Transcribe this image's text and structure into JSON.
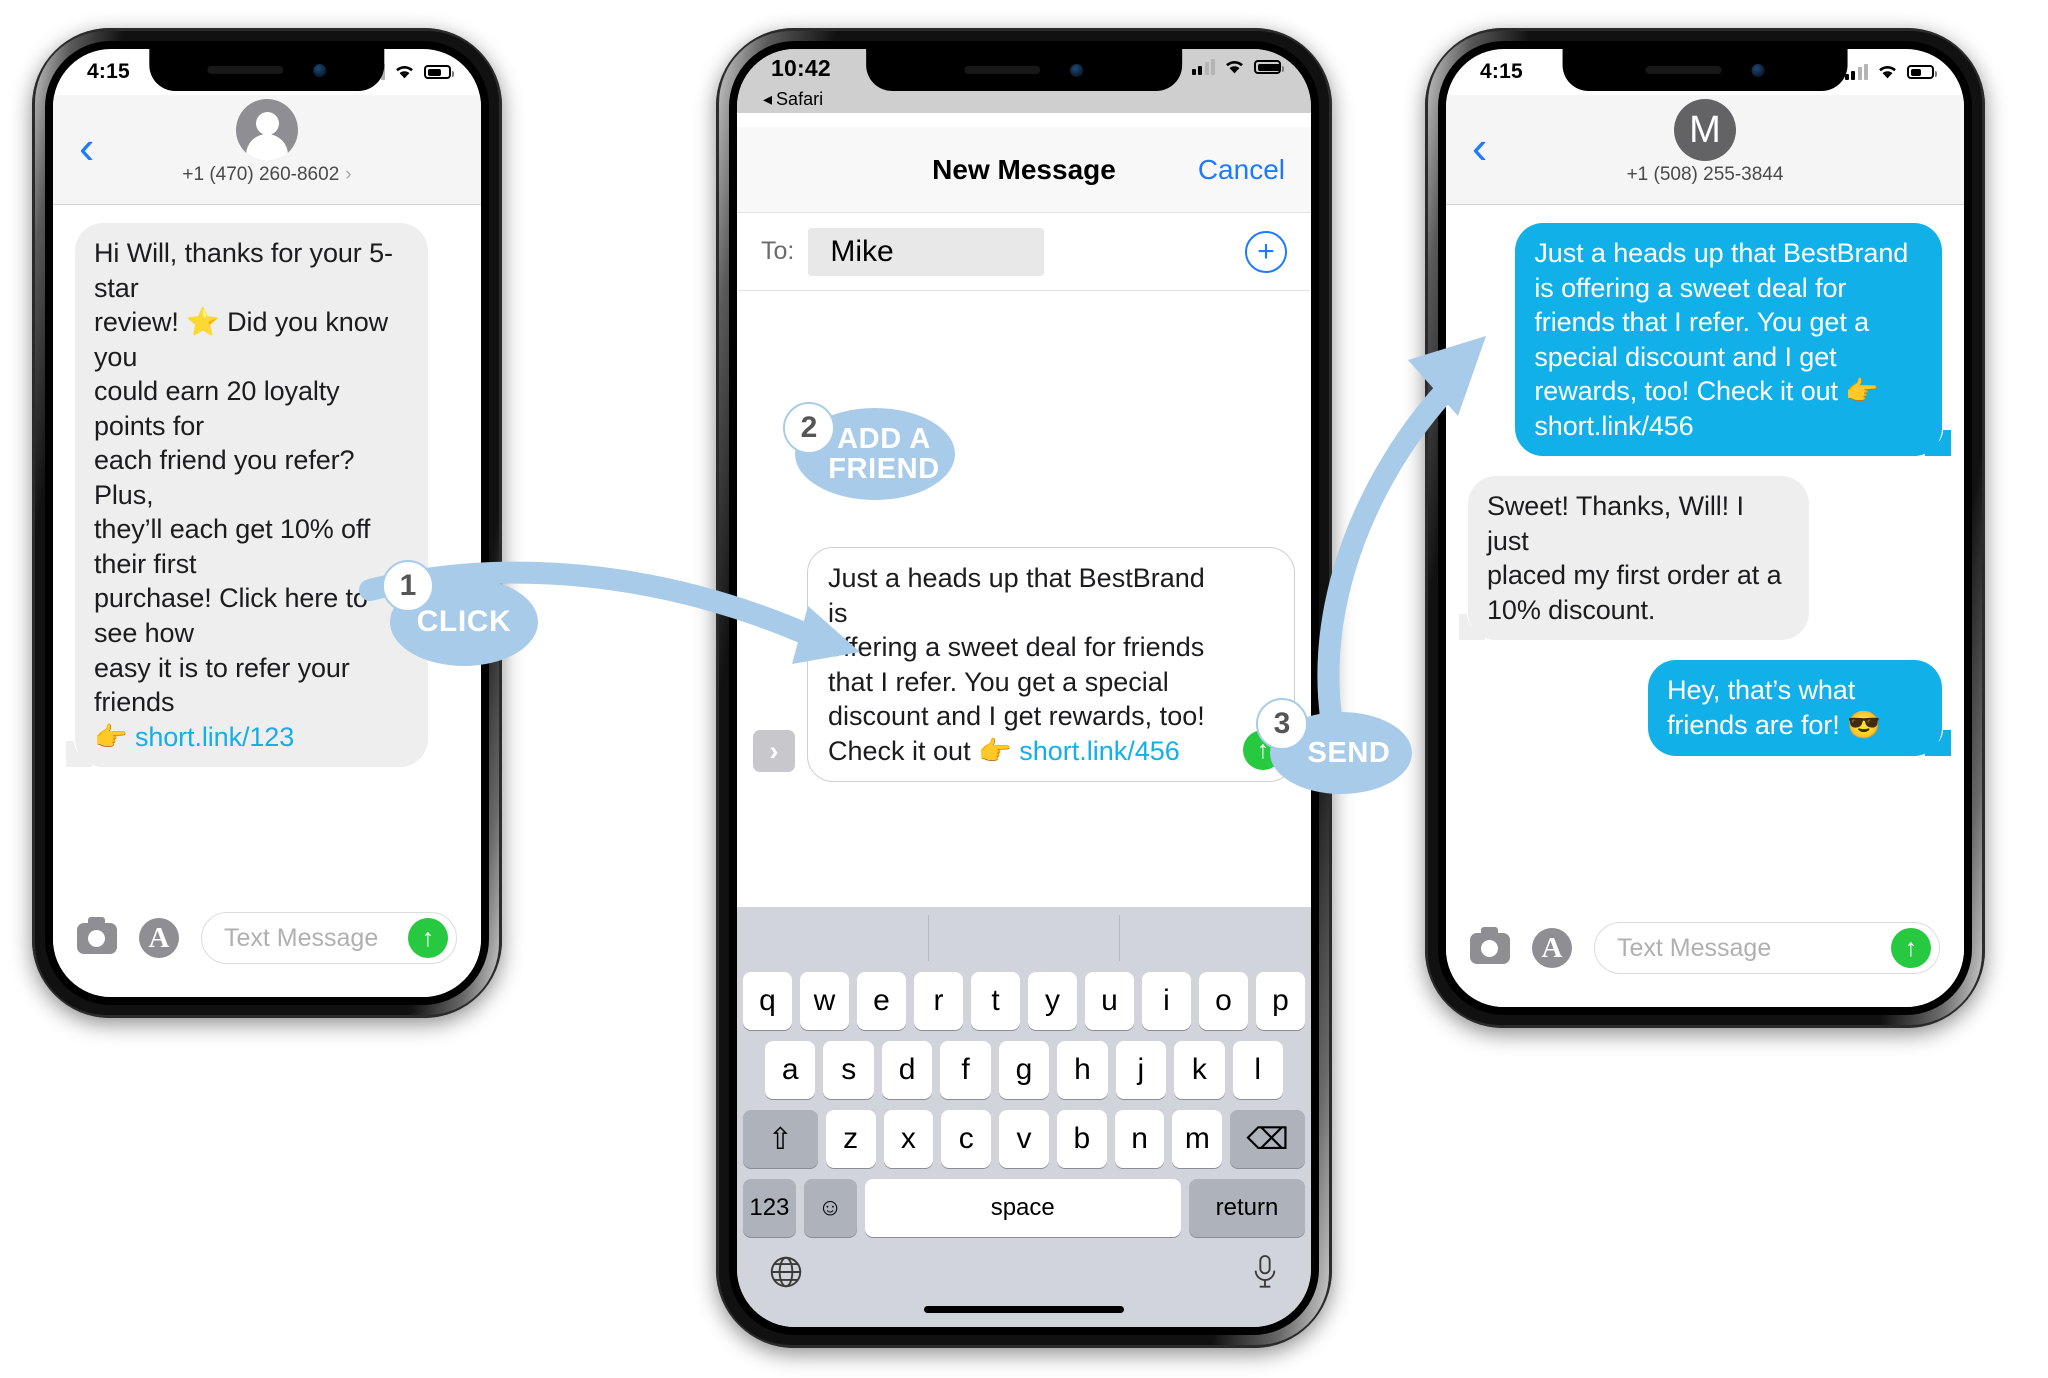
{
  "phones": [
    {
      "id": "phone-inbound",
      "status": {
        "time": "4:15",
        "battery_pct": 60
      },
      "header": {
        "back_icon": "chevron-left-icon",
        "contact": "+1 (470) 260-8602",
        "avatar_type": "person-silhouette"
      },
      "messages": [
        {
          "direction": "in",
          "lines": [
            "Hi Will, thanks for your 5-star",
            "review! ⭐ Did you know you",
            "could earn 20 loyalty points for",
            "each friend you refer? Plus,",
            "they’ll each get 10% off their first",
            "purchase! Click here to see how",
            "easy it is to refer your friends"
          ],
          "emoji_line": "👉",
          "link": "short.link/123"
        }
      ],
      "inputbar": {
        "camera_icon": "camera-icon",
        "appstore_icon": "app-store-icon",
        "placeholder": "Text Message",
        "send_icon": "arrow-up-icon"
      }
    },
    {
      "id": "phone-compose",
      "status": {
        "time": "10:42",
        "back_app": "Safari",
        "battery_pct": 100
      },
      "nav": {
        "title": "New Message",
        "cancel": "Cancel"
      },
      "to_row": {
        "label": "To:",
        "value": "Mike",
        "add_icon": "plus-circle-icon"
      },
      "compose": {
        "expand_icon": "chevron-right-icon",
        "lines": [
          "Just a heads up that BestBrand is",
          "offering a sweet deal for friends",
          "that I refer. You get a special",
          "discount and I get rewards, too!"
        ],
        "last_line_prefix": "Check it out ",
        "emoji": "👉",
        "link": "short.link/456",
        "send_icon": "arrow-up-icon"
      },
      "keyboard": {
        "row1": [
          "q",
          "w",
          "e",
          "r",
          "t",
          "y",
          "u",
          "i",
          "o",
          "p"
        ],
        "row2": [
          "a",
          "s",
          "d",
          "f",
          "g",
          "h",
          "j",
          "k",
          "l"
        ],
        "row3": [
          "z",
          "x",
          "c",
          "v",
          "b",
          "n",
          "m"
        ],
        "shift_icon": "shift-icon",
        "backspace_icon": "backspace-icon",
        "numbers_key": "123",
        "emoji_key": "emoji-icon",
        "space_key": "space",
        "return_key": "return",
        "globe_icon": "globe-icon",
        "mic_icon": "microphone-icon"
      }
    },
    {
      "id": "phone-referral-thread",
      "status": {
        "time": "4:15",
        "battery_pct": 45
      },
      "header": {
        "back_icon": "chevron-left-icon",
        "contact": "+1 (508) 255-3844",
        "avatar_letter": "M"
      },
      "messages": [
        {
          "direction": "out",
          "lines": [
            "Just a heads up that BestBrand",
            "is offering a sweet deal for",
            "friends that I refer. You get a",
            "special discount and I get"
          ],
          "last_line_prefix": "rewards, too! Check it out ",
          "emoji": "👉",
          "link_line": "short.link/456"
        },
        {
          "direction": "in",
          "lines": [
            "Sweet! Thanks, Will! I just",
            "placed my first order at a",
            "10% discount."
          ]
        },
        {
          "direction": "out",
          "lines": [
            "Hey, that’s what",
            "friends are for! 😎"
          ]
        }
      ],
      "inputbar": {
        "camera_icon": "camera-icon",
        "appstore_icon": "app-store-icon",
        "placeholder": "Text Message",
        "send_icon": "arrow-up-icon"
      }
    }
  ],
  "callouts": [
    {
      "id": "callout-click",
      "number": "1",
      "label": "CLICK"
    },
    {
      "id": "callout-add-friend",
      "number": "2",
      "label_line1": "ADD A",
      "label_line2": "FRIEND"
    },
    {
      "id": "callout-send",
      "number": "3",
      "label": "SEND"
    }
  ],
  "colors": {
    "accent_blue": "#12b0e8",
    "ios_blue": "#1f7aff",
    "callout_blue": "#a7cbe8",
    "bubble_gray": "#eeeeee",
    "send_green": "#27c940"
  }
}
